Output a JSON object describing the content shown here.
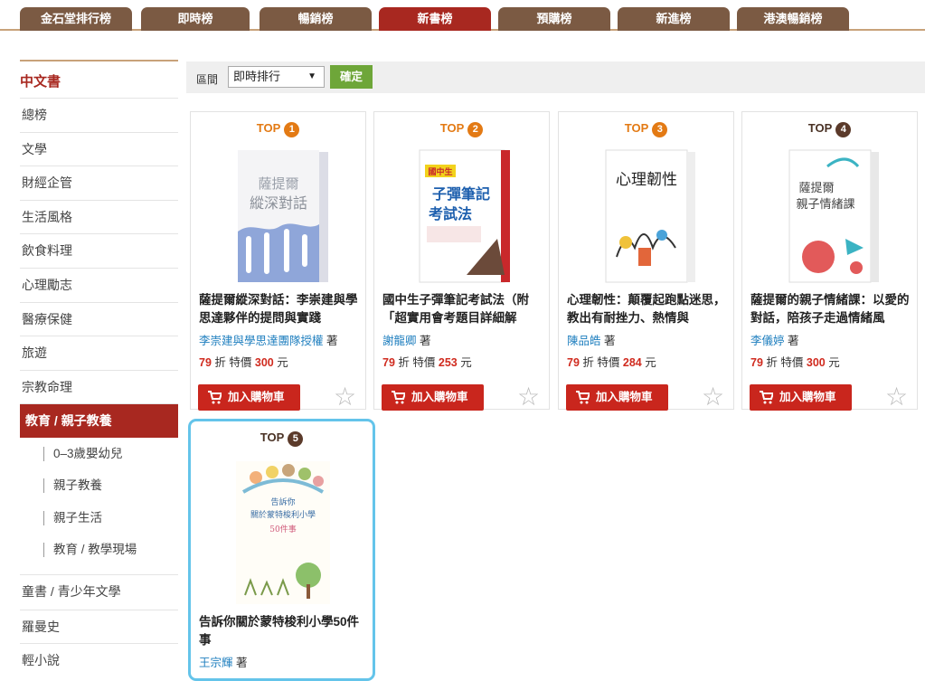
{
  "tabs": [
    {
      "label": "金石堂排行榜"
    },
    {
      "label": "即時榜"
    },
    {
      "label": "暢銷榜"
    },
    {
      "label": "新書榜",
      "active": true
    },
    {
      "label": "預購榜"
    },
    {
      "label": "新進榜"
    },
    {
      "label": "港澳暢銷榜"
    }
  ],
  "sidebar": {
    "heading": "中文書",
    "items": [
      "總榜",
      "文學",
      "財經企管",
      "生活風格",
      "飲食料理",
      "心理勵志",
      "醫療保健",
      "旅遊",
      "宗教命理"
    ],
    "active": "教育 / 親子教養",
    "subitems": [
      "0–3歲嬰幼兒",
      "親子教養",
      "親子生活",
      "教育 / 教學現場"
    ],
    "after": [
      "童書 / 青少年文學",
      "羅曼史",
      "輕小說"
    ]
  },
  "filter": {
    "label": "區間",
    "selected": "即時排行",
    "confirm": "確定"
  },
  "rank_prefix": "TOP",
  "cart_label": "加入購物車",
  "author_suffix": "著",
  "price_words": {
    "discount": "折",
    "special": "特價",
    "unit": "元"
  },
  "books": [
    {
      "rank": "1",
      "title": "薩提爾縱深對話：李崇建與學思達夥伴的提問與實踐",
      "author": "李崇建與學思達團隊授權",
      "discount": "79",
      "price": "300",
      "cover_text": [
        "薩提爾",
        "縱深對話"
      ]
    },
    {
      "rank": "2",
      "title": "國中生子彈筆記考試法（附「超實用會考題目詳細解",
      "author": "謝龍卿",
      "discount": "79",
      "price": "253",
      "cover_text": [
        "國中生",
        "子彈筆記",
        "考試法"
      ]
    },
    {
      "rank": "3",
      "title": "心理韌性：顛覆起跑點迷思，教出有耐挫力、熱情與",
      "author": "陳品皓",
      "discount": "79",
      "price": "284",
      "cover_text": [
        "心理韌性"
      ]
    },
    {
      "rank": "4",
      "title": "薩提爾的親子情緒課：以愛的對話，陪孩子走過情緒風",
      "author": "李儀婷",
      "discount": "79",
      "price": "300",
      "cover_text": [
        "薩提爾",
        "親子情緒課"
      ]
    },
    {
      "rank": "5",
      "title": "告訴你關於蒙特梭利小學50件事",
      "author": "王宗輝",
      "cover_text": [
        "告訴你",
        "關於蒙特梭利小學",
        "50件事"
      ]
    }
  ],
  "colors": {
    "tab": "#7b5a43",
    "tab_active": "#a82820",
    "cart": "#c9261d",
    "rank": "#e37a14",
    "highlight": "#64c4ea"
  }
}
